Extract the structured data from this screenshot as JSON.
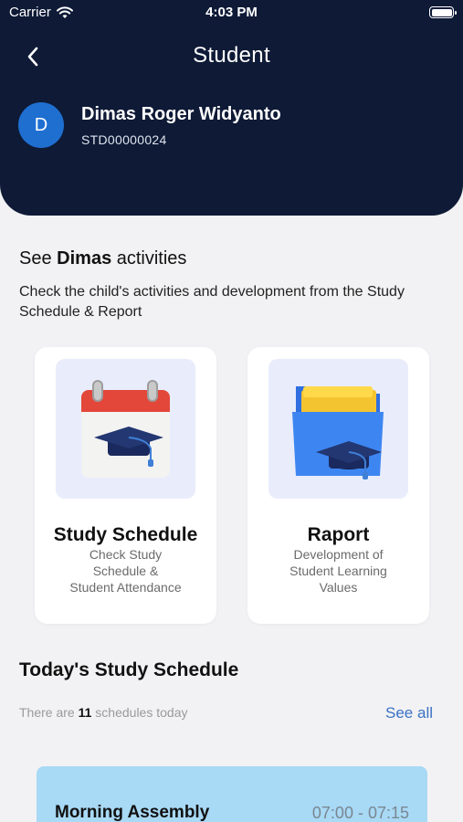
{
  "status_bar": {
    "carrier": "Carrier",
    "time": "4:03 PM"
  },
  "nav": {
    "title": "Student",
    "back_icon": "chevron-left-icon"
  },
  "student": {
    "initial": "D",
    "name": "Dimas Roger Widyanto",
    "id": "STD00000024"
  },
  "activities": {
    "heading_prefix": "See ",
    "heading_name": "Dimas",
    "heading_suffix": " activities",
    "description": "Check the child's activities and development from the Study Schedule & Report",
    "cards": [
      {
        "title": "Study Schedule",
        "description": "Check Study\nSchedule &\nStudent Attendance",
        "icon": "calendar-graduation-cap-icon"
      },
      {
        "title": "Raport",
        "description": "Development of\nStudent Learning\nValues",
        "icon": "folder-graduation-cap-icon"
      }
    ]
  },
  "today": {
    "heading": "Today's Study Schedule",
    "count_prefix": "There are ",
    "count": "11",
    "count_suffix": " schedules today",
    "see_all": "See all",
    "schedules": [
      {
        "name": "Morning Assembly",
        "time": "07:00 - 07:15"
      }
    ]
  },
  "colors": {
    "header_bg": "#0e1a36",
    "avatar": "#1f6fd1",
    "link": "#3a72c4",
    "schedule_card": "#a8d9f5"
  }
}
